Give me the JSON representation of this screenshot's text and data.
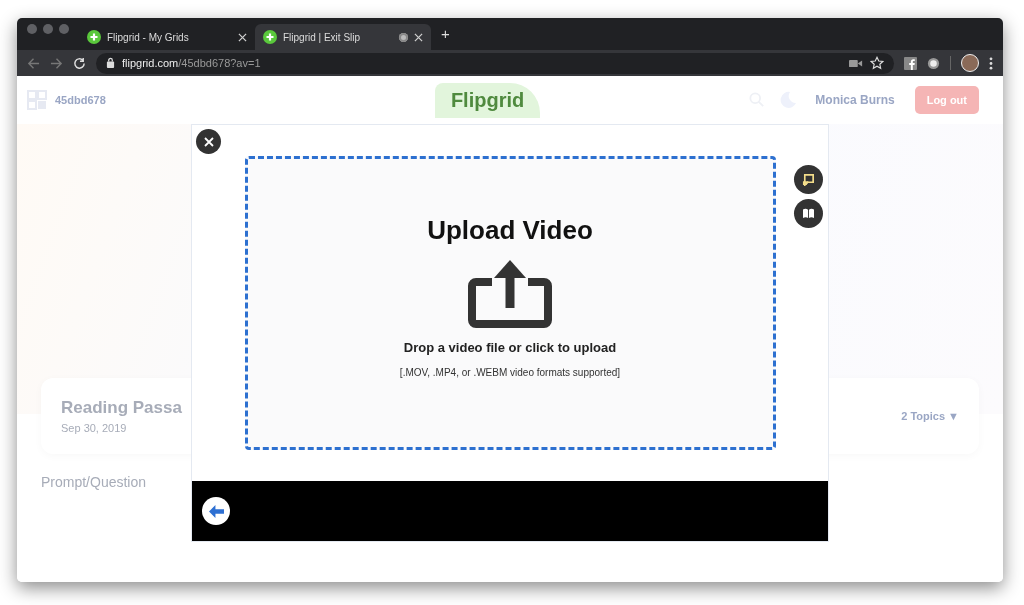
{
  "browser": {
    "tabs": [
      {
        "title": "Flipgrid - My Grids",
        "selected": false,
        "recording": false
      },
      {
        "title": "Flipgrid | Exit Slip",
        "selected": true,
        "recording": true
      }
    ],
    "new_tab": "+",
    "url_host": "flipgrid.com",
    "url_path": "/45dbd678?av=1"
  },
  "page": {
    "grid_code": "45dbd678",
    "logo": "Flipgrid",
    "user": "Monica Burns",
    "logout": "Log out",
    "topic_title": "Reading Passa",
    "topic_date": "Sep 30, 2019",
    "topics_count": "2 Topics ▼",
    "section_label": "Prompt/Question"
  },
  "modal": {
    "title": "Upload Video",
    "instruction": "Drop a video file or click to upload",
    "formats": "[.MOV, .MP4, or .WEBM video formats supported]"
  }
}
